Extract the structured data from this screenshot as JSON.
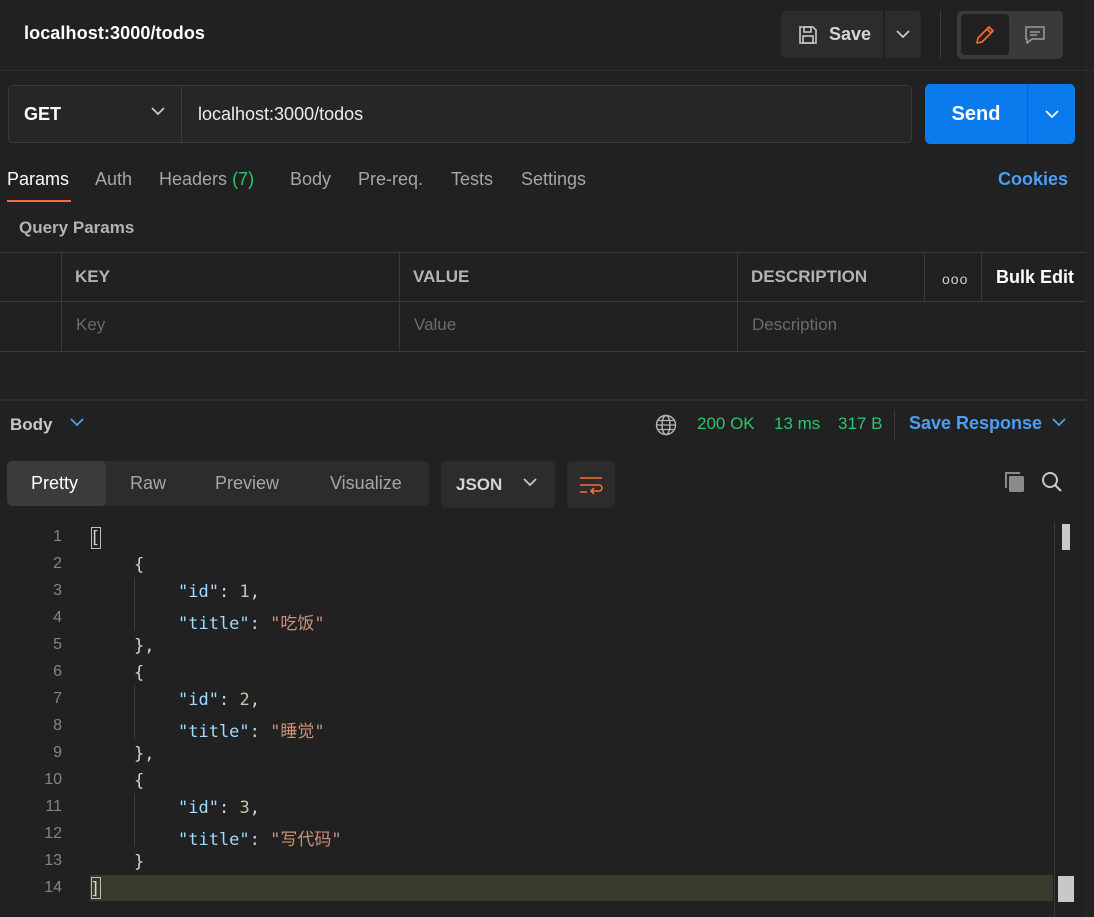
{
  "header": {
    "title": "localhost:3000/todos",
    "save_label": "Save"
  },
  "request": {
    "method": "GET",
    "url": "localhost:3000/todos",
    "send_label": "Send"
  },
  "tabs": [
    {
      "label": "Params"
    },
    {
      "label": "Auth"
    },
    {
      "label": "Headers",
      "count": "(7)"
    },
    {
      "label": "Body"
    },
    {
      "label": "Pre-req."
    },
    {
      "label": "Tests"
    },
    {
      "label": "Settings"
    }
  ],
  "cookies_label": "Cookies",
  "query_params": {
    "label": "Query Params",
    "columns": [
      "KEY",
      "VALUE",
      "DESCRIPTION"
    ],
    "placeholders": [
      "Key",
      "Value",
      "Description"
    ],
    "more_label": "ooo",
    "bulk_edit_label": "Bulk Edit"
  },
  "response": {
    "body_label": "Body",
    "status": "200 OK",
    "time": "13 ms",
    "size": "317 B",
    "save_response_label": "Save Response",
    "view_tabs": [
      "Pretty",
      "Raw",
      "Preview",
      "Visualize"
    ],
    "format": "JSON"
  },
  "code": {
    "line_numbers": [
      "1",
      "2",
      "3",
      "4",
      "5",
      "6",
      "7",
      "8",
      "9",
      "10",
      "11",
      "12",
      "13",
      "14"
    ],
    "items": [
      {
        "id": "1",
        "title": "\"吃饭\""
      },
      {
        "id": "2",
        "title": "\"睡觉\""
      },
      {
        "id": "3",
        "title": "\"写代码\""
      }
    ],
    "tokens": {
      "open_bracket": "[",
      "close_bracket": "]",
      "open_brace": "{",
      "close_brace": "}",
      "close_brace_comma": "},",
      "key_id": "\"id\"",
      "key_title": "\"title\"",
      "colon": ": ",
      "comma": ","
    }
  },
  "colors": {
    "accent_orange": "#ff6c37",
    "send_blue": "#097bed",
    "link_blue": "#4a9ff5",
    "status_green": "#2ac66e"
  }
}
